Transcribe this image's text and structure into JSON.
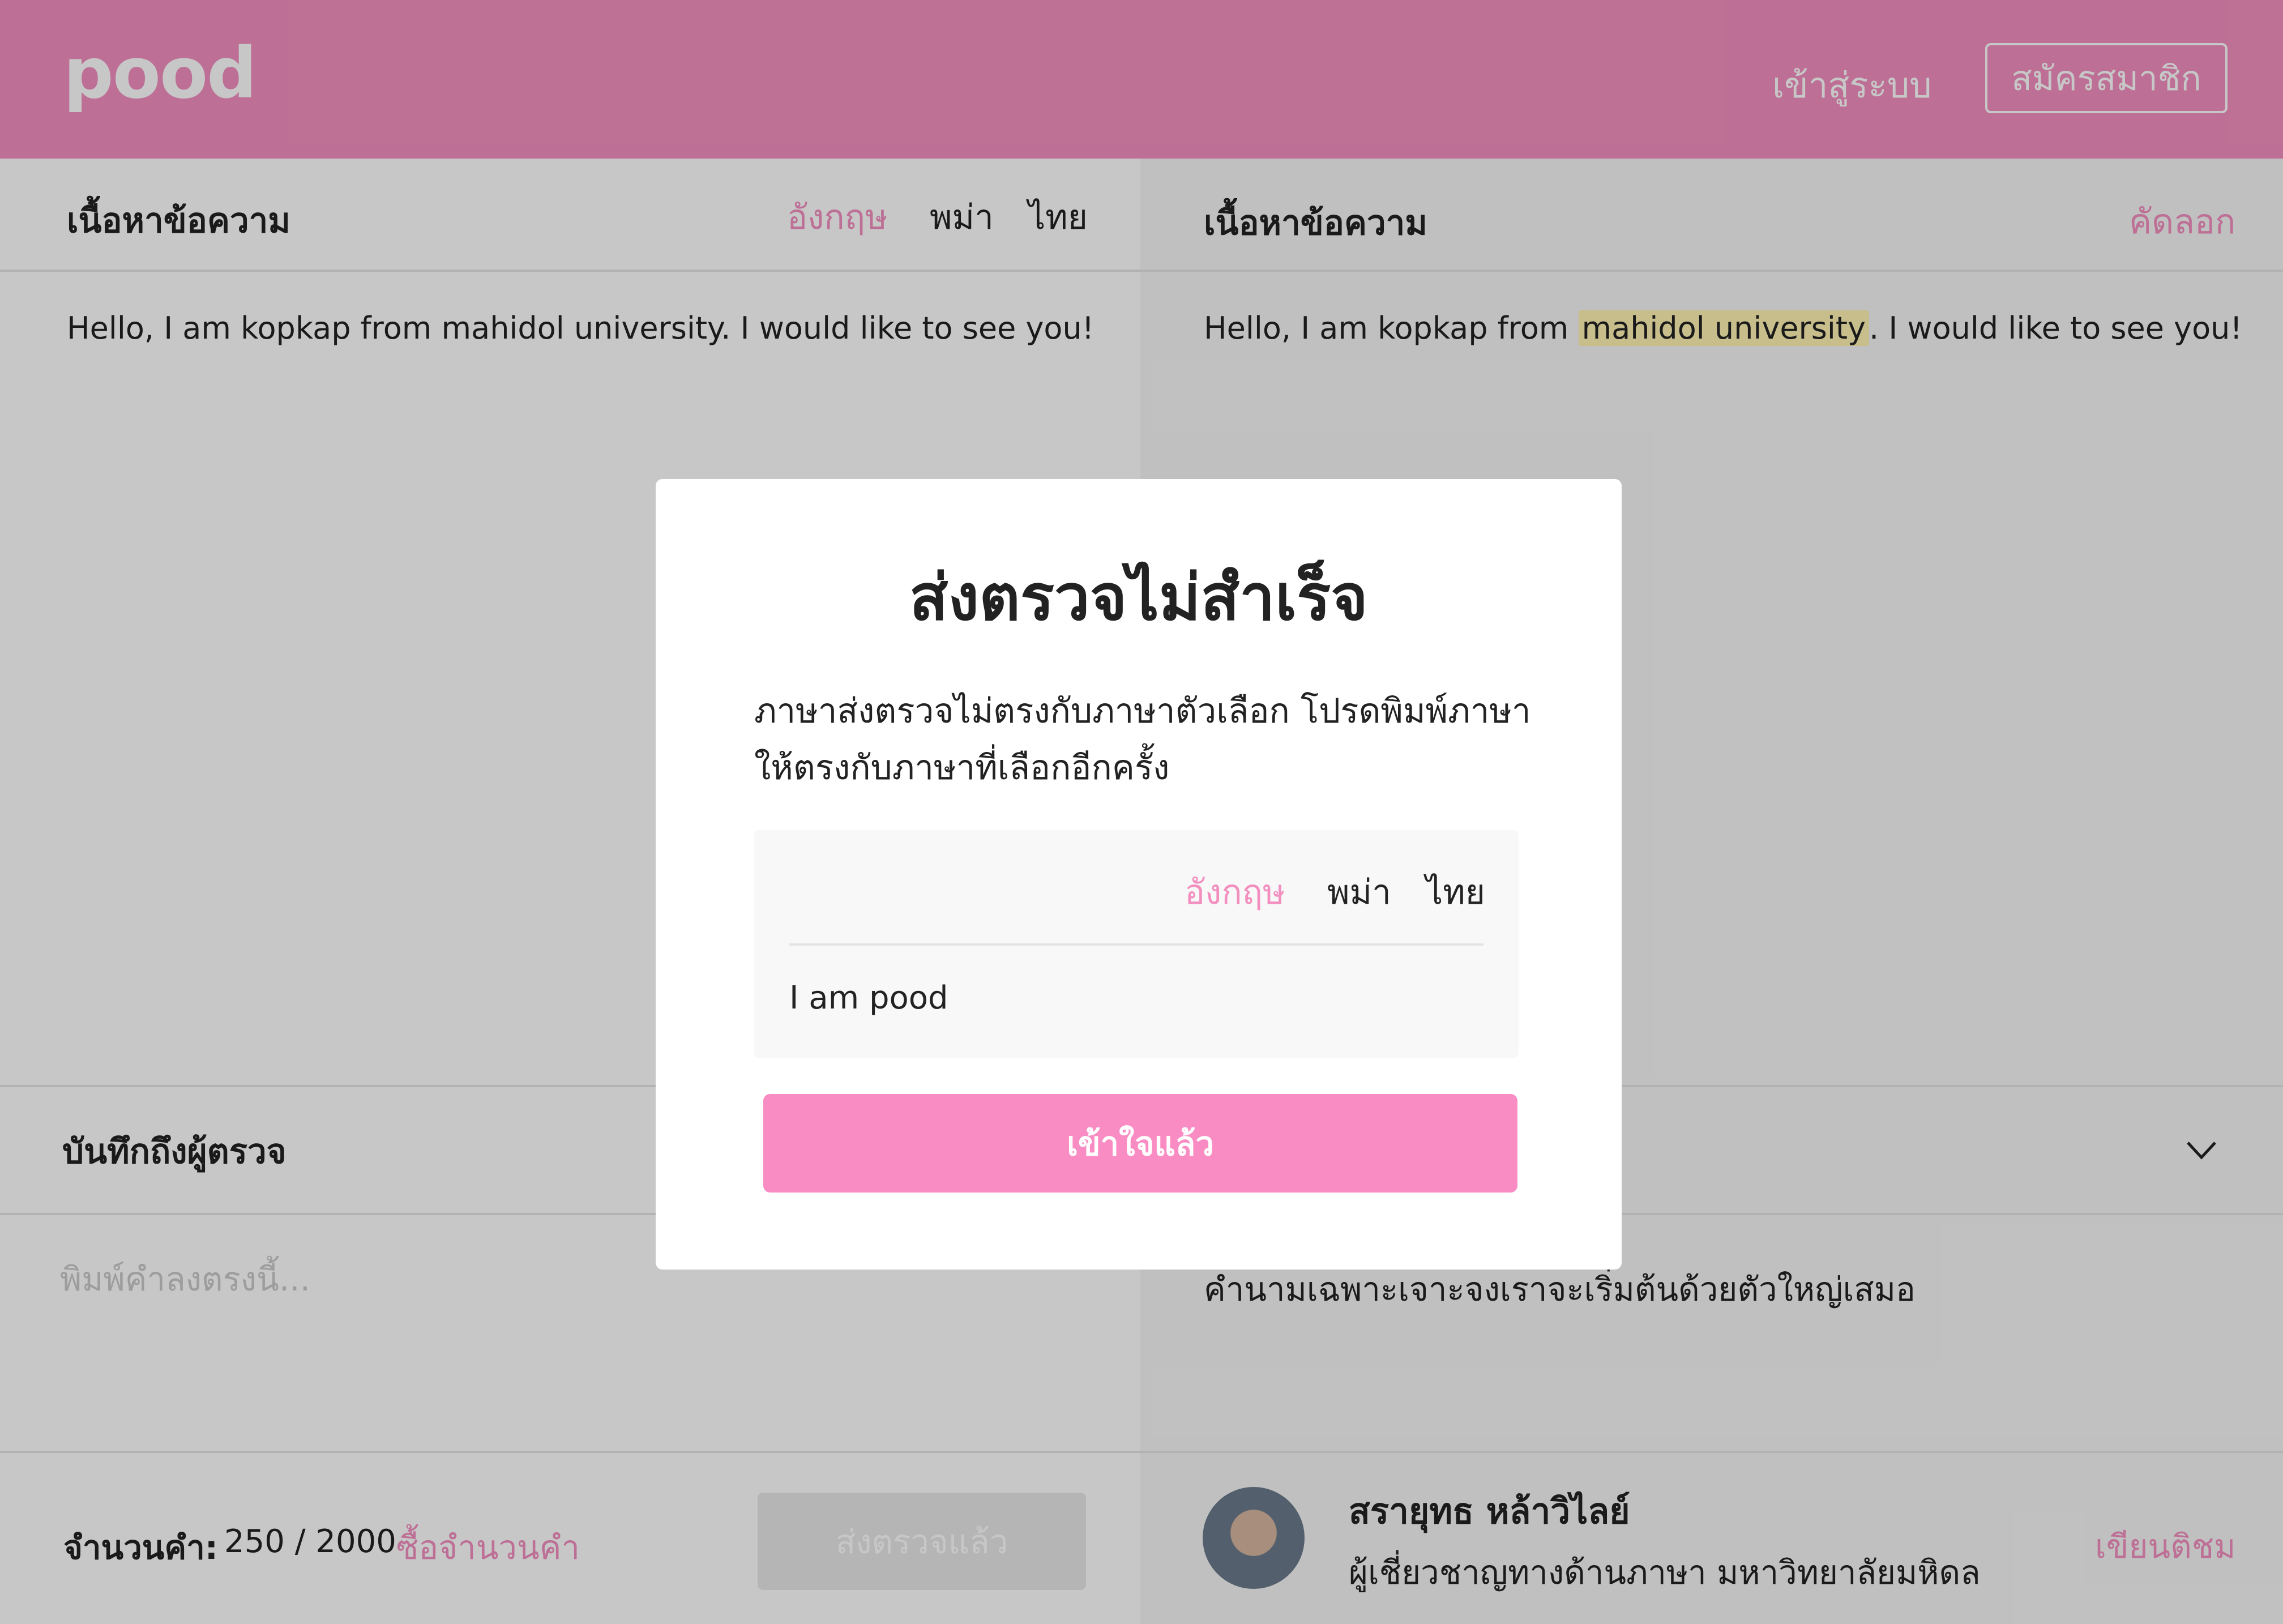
{
  "header": {
    "logo": "pood",
    "login_label": "เข้าสู่ระบบ",
    "register_label": "สมัครสมาชิก"
  },
  "left_panel": {
    "title": "เนื้อหาข้อความ",
    "tabs": [
      {
        "label": "อังกฤษ",
        "active": true
      },
      {
        "label": "พม่า",
        "active": false
      },
      {
        "label": "ไทย",
        "active": false
      }
    ],
    "text": "Hello, I am kopkap from mahidol university. I would like to see you!",
    "note_title": "บันทึกถึงผู้ตรวจ",
    "note_placeholder": "พิมพ์คำลงตรงนี้...",
    "count_label": "จำนวนคำ:",
    "count_value": "250 / 2000",
    "buy_label": "ซื้อจำนวนคำ",
    "send_label": "ส่งตรวจแล้ว"
  },
  "right_panel": {
    "title": "เนื้อหาข้อความ",
    "copy_label": "คัดลอก",
    "text_before": "Hello, I am kopkap from ",
    "text_highlight": "mahidol university",
    "text_after": ". I would like to see you!",
    "note": "คำนามเฉพาะเจาะจงเราจะเริ่มต้นด้วยตัวใหญ่เสมอ",
    "reviewer": {
      "name": "สรายุทธ หล้าวิไลย์",
      "role": "ผู้เชี่ยวชาญทางด้านภาษา มหาวิทยาลัยมหิดล",
      "comment_label": "เขียนติชม"
    }
  },
  "modal": {
    "title": "ส่งตรวจไม่สำเร็จ",
    "description": "ภาษาส่งตรวจไม่ตรงกับภาษาตัวเลือก โปรดพิมพ์ภาษาให้ตรงกับภาษาที่เลือกอีกครั้ง",
    "tabs": [
      {
        "label": "อังกฤษ",
        "active": true
      },
      {
        "label": "พม่า",
        "active": false
      },
      {
        "label": "ไทย",
        "active": false
      }
    ],
    "input_text": "I am pood",
    "confirm_label": "เข้าใจแล้ว"
  },
  "colors": {
    "brand_pink": "#f38fbf",
    "button_pink": "#f98dc3",
    "highlight": "#fff4b4"
  }
}
